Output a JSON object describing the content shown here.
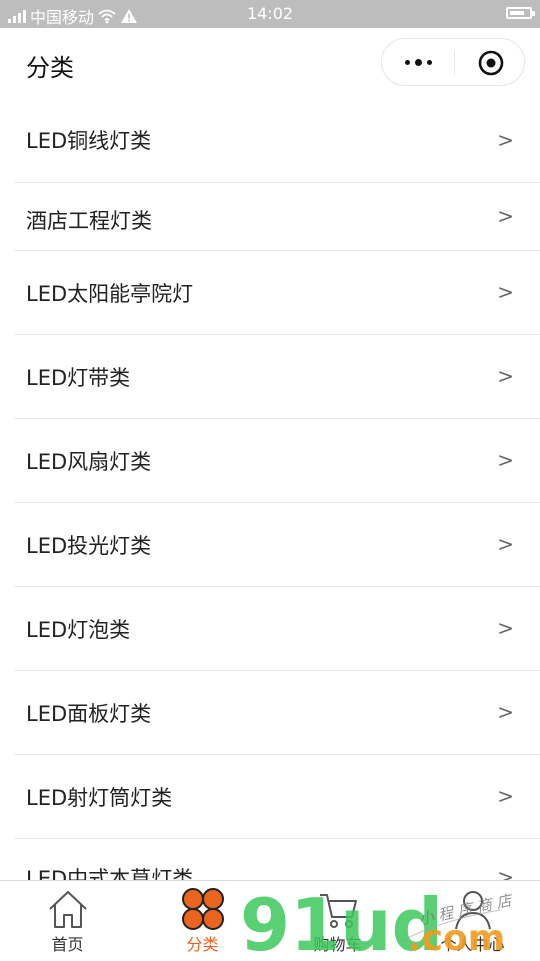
{
  "status_bar": {
    "carrier": "中国移动",
    "time": "14:02"
  },
  "nav": {
    "title": "分类"
  },
  "categories": [
    {
      "label": "LED铜线灯类",
      "chevron": ">"
    },
    {
      "label": "酒店工程灯类",
      "chevron": ">"
    },
    {
      "label": "LED太阳能亭院灯",
      "chevron": ">"
    },
    {
      "label": "LED灯带类",
      "chevron": ">"
    },
    {
      "label": "LED风扇灯类",
      "chevron": ">"
    },
    {
      "label": "LED投光灯类",
      "chevron": ">"
    },
    {
      "label": "LED灯泡类",
      "chevron": ">"
    },
    {
      "label": "LED面板灯类",
      "chevron": ">"
    },
    {
      "label": "LED射灯筒灯类",
      "chevron": ">"
    },
    {
      "label": "LED中式本草灯类",
      "chevron": ">"
    }
  ],
  "tab_bar": {
    "tabs": [
      {
        "label": "首页",
        "icon": "home-icon"
      },
      {
        "label": "分类",
        "icon": "category-clover-icon",
        "active": true
      },
      {
        "label": "购物车",
        "icon": "cart-icon"
      },
      {
        "label": "个人中心",
        "icon": "person-icon"
      }
    ]
  },
  "watermark": {
    "brand": "91ud",
    "suffix": ".com",
    "handwriting": "小程序商店"
  },
  "colors": {
    "accent": "#e8641f",
    "status_bar_bg": "#bdbdbd",
    "watermark_green": "#3cc85a",
    "watermark_orange": "#f39a1e"
  }
}
